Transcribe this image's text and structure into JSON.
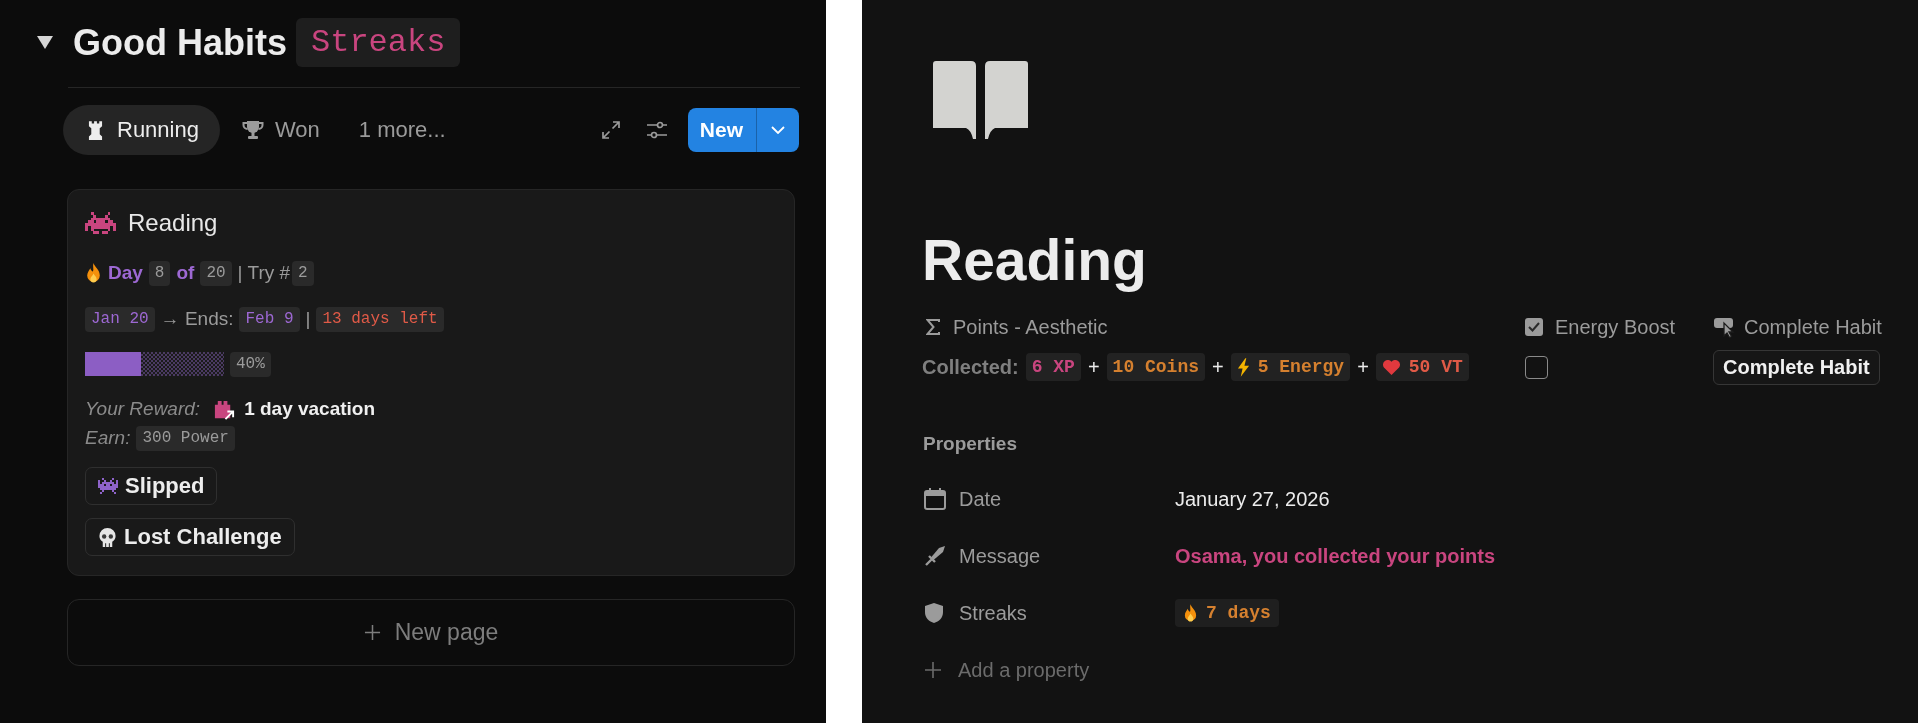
{
  "board": {
    "expanded": true,
    "title": "Good Habits",
    "tag": "Streaks",
    "views": [
      {
        "label": "Running",
        "selected": true
      },
      {
        "label": "Won",
        "selected": false
      }
    ],
    "more_views": "1 more...",
    "new_button": "New",
    "card": {
      "title": "Reading",
      "streak": {
        "day_label": "Day",
        "day": "8",
        "of_label": "of",
        "total": "20",
        "try_label": "| Try #",
        "try": "2"
      },
      "dates": {
        "start": "Jan 20",
        "ends_label": "→ Ends:",
        "end": "Feb 9",
        "separator": "|",
        "remaining": "13 days left"
      },
      "progress": {
        "level": 0.4,
        "reading": "40%"
      },
      "reward": {
        "label": "Your Reward:",
        "value": "1 day vacation"
      },
      "earn": {
        "label": "Earn:",
        "value": "300 Power"
      },
      "tags": [
        "Slipped",
        "Lost Challenge"
      ]
    },
    "new_page": "New page"
  },
  "page": {
    "title": "Reading",
    "points": {
      "label": "Points - Aesthetic",
      "prefix": "Collected:",
      "chips": [
        {
          "text": "6 XP",
          "color": "#c9457f"
        },
        {
          "text": "10 Coins",
          "color": "#d5802f"
        },
        {
          "text": "5 Energy",
          "color": "#d5802f"
        },
        {
          "text": "50 VT",
          "color": "#e05a47"
        }
      ],
      "joiners": [
        "+",
        "+",
        "+"
      ]
    },
    "checkbox": {
      "label": "Energy Boost",
      "checked": false
    },
    "action": {
      "label": "Complete Habit",
      "button": "Complete Habit"
    },
    "properties_heading": "Properties",
    "properties": [
      {
        "kind": "date",
        "label": "Date",
        "value": "January 27, 2026"
      },
      {
        "kind": "formula",
        "label": "Message",
        "value": "Osama, you collected your points"
      },
      {
        "kind": "tag",
        "label": "Streaks",
        "value": "7 days"
      }
    ],
    "add_property": "Add a property"
  }
}
